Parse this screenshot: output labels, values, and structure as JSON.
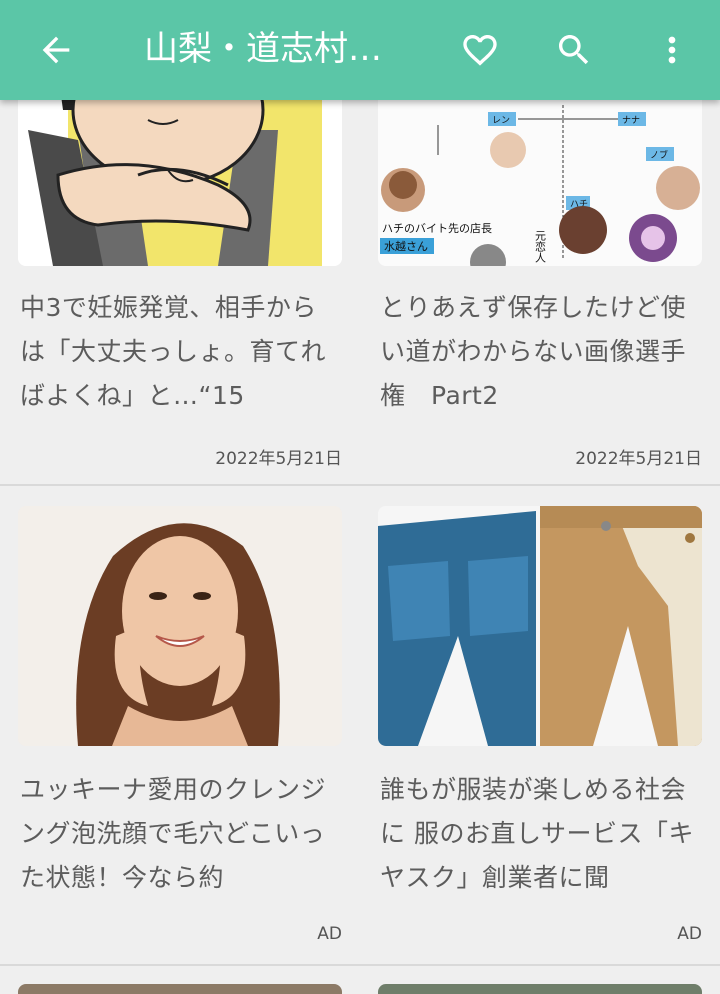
{
  "header": {
    "title": "山梨・道志村…",
    "back_icon": "arrow-back-icon",
    "favorite_icon": "heart-outline-icon",
    "search_icon": "search-icon",
    "more_icon": "more-vert-icon"
  },
  "colors": {
    "appbar": "#5bc6a7",
    "background": "#efefef",
    "title_text": "#5c5c5c"
  },
  "articles": [
    {
      "title": "中3で妊娠発覚、相手からは「大丈夫っしょ。育てればよくね」と…“15",
      "meta": "2022年5月21日",
      "image_desc": "illustration-woman-chin-on-hands"
    },
    {
      "title": "とりあえず保存したけど使い道がわからない画像選手権　Part2",
      "meta": "2022年5月21日",
      "image_desc": "relationship-chart-with-faces",
      "image_labels": [
        "ハチのバイト先の店長",
        "水越さん",
        "レン",
        "ナナ",
        "ノブ",
        "ハチ",
        "元恋人"
      ]
    },
    {
      "title": "ユッキーナ愛用のクレンジング泡洗顔で毛穴どこいった状態！今なら約",
      "meta": "AD",
      "image_desc": "smiling-woman-hands-on-cheeks"
    },
    {
      "title": "誰もが服装が楽しめる社会に 服のお直しサービス「キヤスク」創業者に聞",
      "meta": "AD",
      "image_desc": "denim-and-khaki-pants"
    }
  ]
}
